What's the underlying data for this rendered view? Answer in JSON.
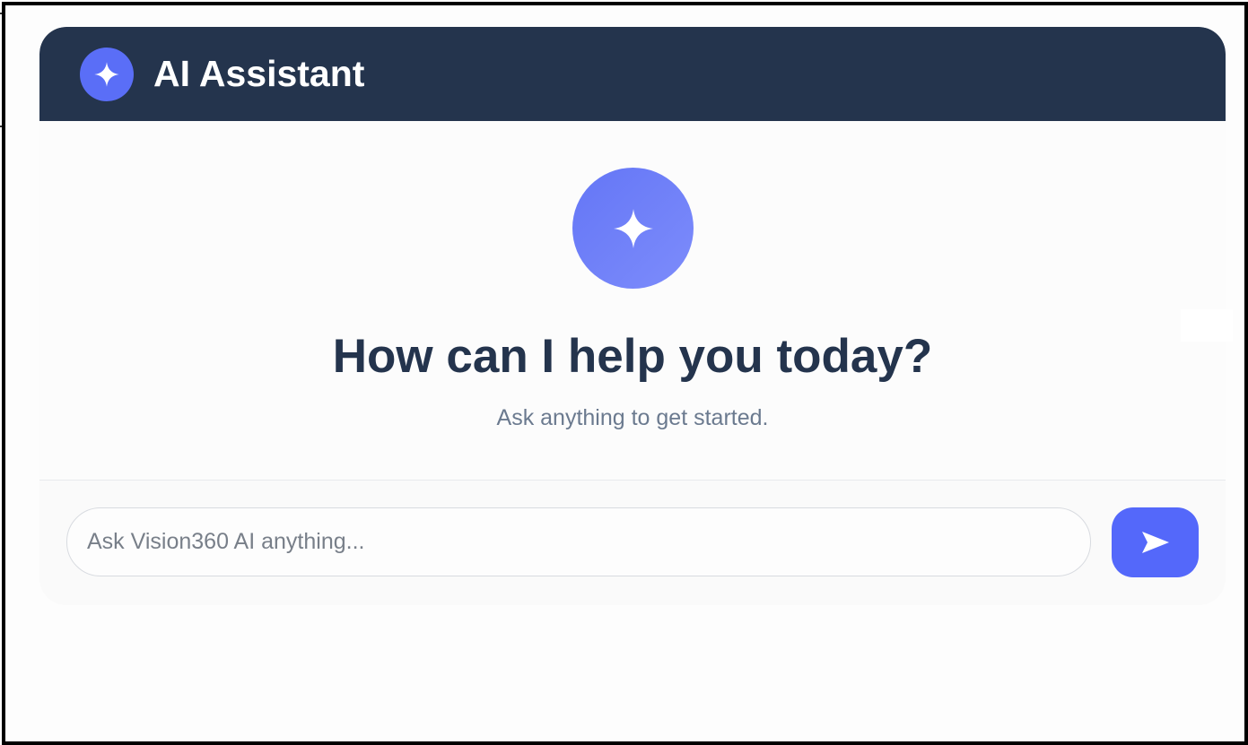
{
  "header": {
    "title": "AI Assistant",
    "logo_icon": "sparkle-icon"
  },
  "welcome": {
    "icon": "sparkle-icon",
    "title": "How can I help you today?",
    "subtitle": "Ask anything to get started."
  },
  "composer": {
    "input_value": "",
    "input_placeholder": "Ask Vision360 AI anything...",
    "send_icon": "send-arrow-icon"
  },
  "colors": {
    "header_bg": "#24344d",
    "accent": "#5468fa",
    "title_text": "#24344d",
    "subtitle_text": "#6b7a8f"
  }
}
